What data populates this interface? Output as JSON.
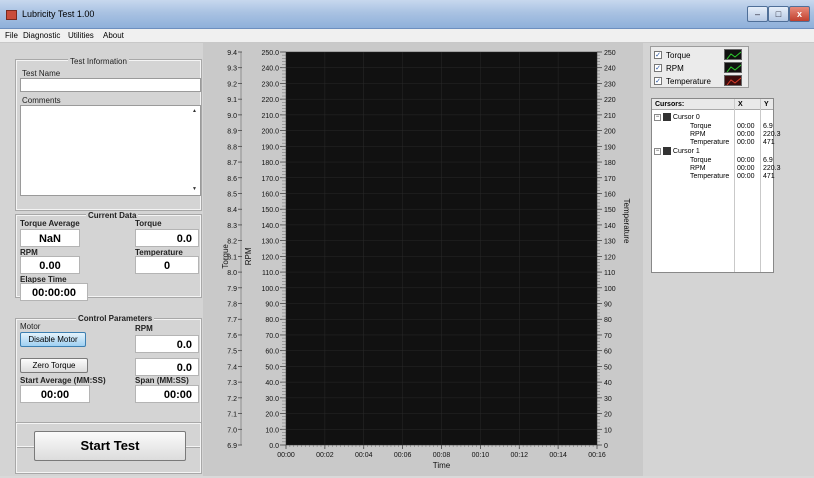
{
  "window": {
    "title": "Lubricity Test 1.00"
  },
  "menu": [
    "File",
    "Diagnostic",
    "Utilities",
    "About"
  ],
  "test_info": {
    "group_title": "Test Information",
    "test_name_label": "Test Name",
    "test_name_value": "",
    "comments_label": "Comments",
    "comments_value": ""
  },
  "current_data": {
    "group_title": "Current Data",
    "torque_average_label": "Torque Average",
    "torque_average_value": "NaN",
    "torque_label": "Torque",
    "torque_value": "0.0",
    "rpm_label": "RPM",
    "rpm_value": "0.00",
    "temperature_label": "Temperature",
    "temperature_value": "0",
    "elapse_label": "Elapse Time",
    "elapse_value": "00:00:00"
  },
  "control": {
    "group_title": "Control Parameters",
    "motor_label": "Motor",
    "disable_motor_button": "Disable Motor",
    "rpm_label": "RPM",
    "rpm_value": "0.0",
    "zero_torque_button": "Zero Torque",
    "zero_torque_value": "0.0",
    "start_avg_label": "Start Average (MM:SS)",
    "start_avg_value": "00:00",
    "span_label": "Span (MM:SS)",
    "span_value": "00:00"
  },
  "start_button": "Start Test",
  "chart_data": {
    "type": "line",
    "xlabel": "Time",
    "x_ticks": [
      "00:00",
      "00:02",
      "00:04",
      "00:06",
      "00:08",
      "00:10",
      "00:12",
      "00:14",
      "00:16"
    ],
    "y_left_outer": {
      "label": "Torque",
      "ylim": [
        6.9,
        9.4
      ],
      "ticks": [
        "9.4",
        "9.3",
        "9.2",
        "9.1",
        "9.0",
        "8.9",
        "8.8",
        "8.7",
        "8.6",
        "8.5",
        "8.4",
        "8.3",
        "8.2",
        "8.1",
        "8.0",
        "7.9",
        "7.8",
        "7.7",
        "7.6",
        "7.5",
        "7.4",
        "7.3",
        "7.2",
        "7.1",
        "7.0",
        "6.9"
      ]
    },
    "y_left_inner": {
      "label": "RPM",
      "ylim": [
        0,
        250
      ],
      "ticks": [
        "250.0",
        "240.0",
        "230.0",
        "220.0",
        "210.0",
        "200.0",
        "190.0",
        "180.0",
        "170.0",
        "160.0",
        "150.0",
        "140.0",
        "130.0",
        "120.0",
        "110.0",
        "100.0",
        "90.0",
        "80.0",
        "70.0",
        "60.0",
        "50.0",
        "40.0",
        "30.0",
        "20.0",
        "10.0",
        "0.0"
      ]
    },
    "y_right": {
      "label": "Temperature",
      "ylim": [
        0,
        250
      ],
      "ticks": [
        "250",
        "240",
        "230",
        "220",
        "210",
        "200",
        "190",
        "180",
        "170",
        "160",
        "150",
        "140",
        "130",
        "120",
        "110",
        "100",
        "90",
        "80",
        "70",
        "60",
        "50",
        "40",
        "30",
        "20",
        "10",
        "0"
      ]
    },
    "series": [
      {
        "name": "Torque",
        "values": [],
        "color": "#2ecc2e"
      },
      {
        "name": "RPM",
        "values": [],
        "color": "#2ecc2e"
      },
      {
        "name": "Temperature",
        "values": [],
        "color": "#d43a2a"
      }
    ],
    "grid": true,
    "plot_background": "#111111"
  },
  "legend": [
    {
      "label": "Torque",
      "checked": true,
      "color": "#2ecc2e"
    },
    {
      "label": "RPM",
      "checked": true,
      "color": "#2ecc2e"
    },
    {
      "label": "Temperature",
      "checked": true,
      "color": "#d43a2a"
    }
  ],
  "cursors_table": {
    "headers": [
      "Cursors:",
      "X",
      "Y"
    ],
    "cursors": [
      {
        "name": "Cursor 0",
        "rows": [
          {
            "label": "Torque",
            "x": "00:00",
            "y": "6.9"
          },
          {
            "label": "RPM",
            "x": "00:00",
            "y": "220.3"
          },
          {
            "label": "Temperature",
            "x": "00:00",
            "y": "471"
          }
        ]
      },
      {
        "name": "Cursor 1",
        "rows": [
          {
            "label": "Torque",
            "x": "00:00",
            "y": "6.9"
          },
          {
            "label": "RPM",
            "x": "00:00",
            "y": "220.3"
          },
          {
            "label": "Temperature",
            "x": "00:00",
            "y": "471"
          }
        ]
      }
    ]
  }
}
